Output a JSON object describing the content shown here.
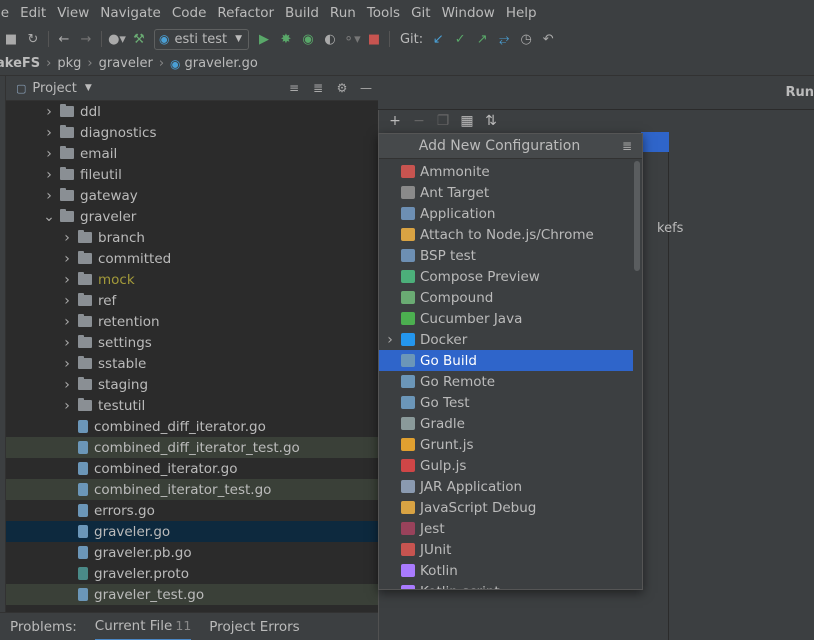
{
  "menu": [
    "le",
    "Edit",
    "View",
    "Navigate",
    "Code",
    "Refactor",
    "Build",
    "Run",
    "Tools",
    "Git",
    "Window",
    "Help"
  ],
  "toolbar": {
    "run_config_label": "esti test",
    "git_label": "Git:"
  },
  "breadcrumbs": [
    "akeFS",
    "pkg",
    "graveler",
    "graveler.go"
  ],
  "project_panel": {
    "title": "Project"
  },
  "tree": [
    {
      "label": "ddl",
      "type": "folder",
      "depth": 1,
      "expanded": false
    },
    {
      "label": "diagnostics",
      "type": "folder",
      "depth": 1,
      "expanded": false
    },
    {
      "label": "email",
      "type": "folder",
      "depth": 1,
      "expanded": false
    },
    {
      "label": "fileutil",
      "type": "folder",
      "depth": 1,
      "expanded": false
    },
    {
      "label": "gateway",
      "type": "folder",
      "depth": 1,
      "expanded": false
    },
    {
      "label": "graveler",
      "type": "folder",
      "depth": 1,
      "expanded": true
    },
    {
      "label": "branch",
      "type": "folder",
      "depth": 2,
      "expanded": false
    },
    {
      "label": "committed",
      "type": "folder",
      "depth": 2,
      "expanded": false
    },
    {
      "label": "mock",
      "type": "folder",
      "depth": 2,
      "expanded": false,
      "style": "mock"
    },
    {
      "label": "ref",
      "type": "folder",
      "depth": 2,
      "expanded": false
    },
    {
      "label": "retention",
      "type": "folder",
      "depth": 2,
      "expanded": false
    },
    {
      "label": "settings",
      "type": "folder",
      "depth": 2,
      "expanded": false
    },
    {
      "label": "sstable",
      "type": "folder",
      "depth": 2,
      "expanded": false
    },
    {
      "label": "staging",
      "type": "folder",
      "depth": 2,
      "expanded": false
    },
    {
      "label": "testutil",
      "type": "folder",
      "depth": 2,
      "expanded": false
    },
    {
      "label": "combined_diff_iterator.go",
      "type": "go",
      "depth": 2
    },
    {
      "label": "combined_diff_iterator_test.go",
      "type": "go",
      "depth": 2,
      "state": "changed"
    },
    {
      "label": "combined_iterator.go",
      "type": "go",
      "depth": 2
    },
    {
      "label": "combined_iterator_test.go",
      "type": "go",
      "depth": 2,
      "state": "changed"
    },
    {
      "label": "errors.go",
      "type": "go",
      "depth": 2
    },
    {
      "label": "graveler.go",
      "type": "go",
      "depth": 2,
      "state": "selected"
    },
    {
      "label": "graveler.pb.go",
      "type": "go",
      "depth": 2
    },
    {
      "label": "graveler.proto",
      "type": "proto",
      "depth": 2
    },
    {
      "label": "graveler_test.go",
      "type": "go",
      "depth": 2,
      "state": "changed"
    }
  ],
  "bottom_bar": {
    "problems_label": "Problems:",
    "current_file_label": "Current File",
    "current_file_count": "11",
    "project_errors_label": "Project Errors"
  },
  "dialog": {
    "title": "Run",
    "side_text": "kefs"
  },
  "popup": {
    "title": "Add New Configuration",
    "items": [
      {
        "label": "Ammonite",
        "icon": "ammonite-icon",
        "color": "#c75450"
      },
      {
        "label": "Ant Target",
        "icon": "ant-icon",
        "color": "#8a8a8a"
      },
      {
        "label": "Application",
        "icon": "application-icon",
        "color": "#6d8fb3"
      },
      {
        "label": "Attach to Node.js/Chrome",
        "icon": "nodejs-icon",
        "color": "#d9a343"
      },
      {
        "label": "BSP test",
        "icon": "bsp-icon",
        "color": "#6d8fb3"
      },
      {
        "label": "Compose Preview",
        "icon": "compose-icon",
        "color": "#4caf7a"
      },
      {
        "label": "Compound",
        "icon": "compound-icon",
        "color": "#6aab73"
      },
      {
        "label": "Cucumber Java",
        "icon": "cucumber-icon",
        "color": "#4caf50"
      },
      {
        "label": "Docker",
        "icon": "docker-icon",
        "color": "#2496ed",
        "expandable": true
      },
      {
        "label": "Go Build",
        "icon": "go-icon",
        "color": "#6b96b8",
        "selected": true
      },
      {
        "label": "Go Remote",
        "icon": "go-remote-icon",
        "color": "#6b96b8"
      },
      {
        "label": "Go Test",
        "icon": "go-test-icon",
        "color": "#6b96b8"
      },
      {
        "label": "Gradle",
        "icon": "gradle-icon",
        "color": "#8a9a9a"
      },
      {
        "label": "Grunt.js",
        "icon": "grunt-icon",
        "color": "#e0a030"
      },
      {
        "label": "Gulp.js",
        "icon": "gulp-icon",
        "color": "#cf4647"
      },
      {
        "label": "JAR Application",
        "icon": "jar-icon",
        "color": "#8a9ab0"
      },
      {
        "label": "JavaScript Debug",
        "icon": "js-debug-icon",
        "color": "#d9a343"
      },
      {
        "label": "Jest",
        "icon": "jest-icon",
        "color": "#99425b"
      },
      {
        "label": "JUnit",
        "icon": "junit-icon",
        "color": "#c75450"
      },
      {
        "label": "Kotlin",
        "icon": "kotlin-icon",
        "color": "#a97bff"
      },
      {
        "label": "Kotlin script",
        "icon": "kotlin-script-icon",
        "color": "#a97bff"
      }
    ]
  }
}
